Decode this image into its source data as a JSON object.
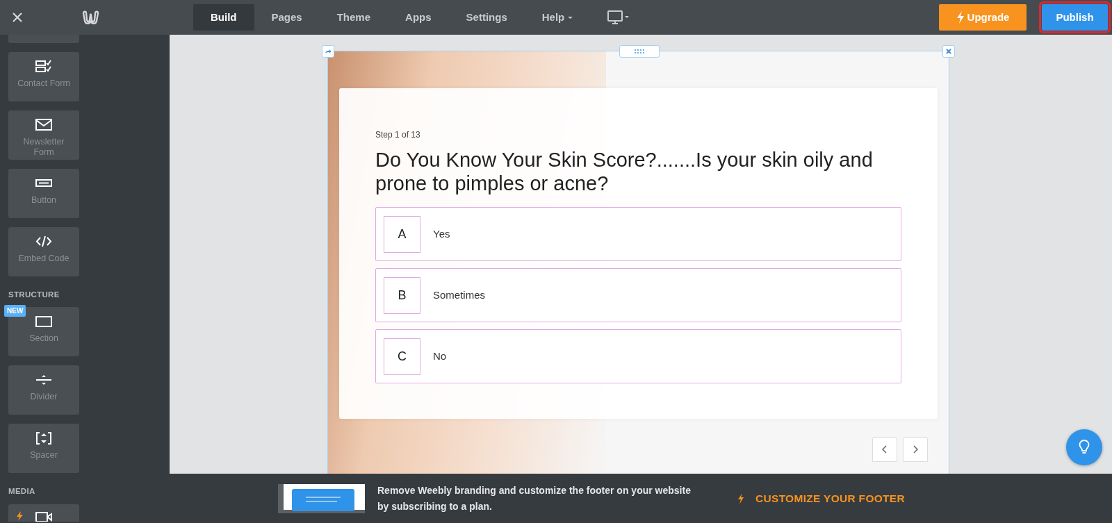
{
  "topbar": {
    "tabs": [
      {
        "label": "Build",
        "selected": true,
        "dropdown": false
      },
      {
        "label": "Pages",
        "selected": false,
        "dropdown": false
      },
      {
        "label": "Theme",
        "selected": false,
        "dropdown": false
      },
      {
        "label": "Apps",
        "selected": false,
        "dropdown": false
      },
      {
        "label": "Settings",
        "selected": false,
        "dropdown": false
      },
      {
        "label": "Help",
        "selected": false,
        "dropdown": true
      }
    ],
    "upgrade": "Upgrade",
    "publish": {
      "label": "Publish",
      "highlighted": true
    }
  },
  "sidebar": {
    "items": [
      {
        "kind": "stub"
      },
      {
        "kind": "tile",
        "label": "Contact Form"
      },
      {
        "kind": "tile",
        "label": "Newsletter Form"
      },
      {
        "kind": "tile",
        "label": "Button"
      },
      {
        "kind": "tile",
        "label": "Embed Code"
      },
      {
        "kind": "heading",
        "label": "STRUCTURE"
      },
      {
        "kind": "tile",
        "label": "Section",
        "badge": "NEW"
      },
      {
        "kind": "tile",
        "label": "Divider"
      },
      {
        "kind": "tile",
        "label": "Spacer"
      },
      {
        "kind": "heading",
        "label": "MEDIA"
      },
      {
        "kind": "peek",
        "premium": true
      }
    ]
  },
  "quiz": {
    "step": "Step 1 of 13",
    "question": "Do You Know Your Skin Score?.......Is your skin oily and prone to pimples or acne?",
    "options": [
      {
        "letter": "A",
        "text": "Yes"
      },
      {
        "letter": "B",
        "text": "Sometimes"
      },
      {
        "letter": "C",
        "text": "No"
      }
    ]
  },
  "footer": {
    "text": "Remove Weebly branding and customize the footer on your website by subscribing to a plan.",
    "cta": "CUSTOMIZE YOUR FOOTER"
  }
}
